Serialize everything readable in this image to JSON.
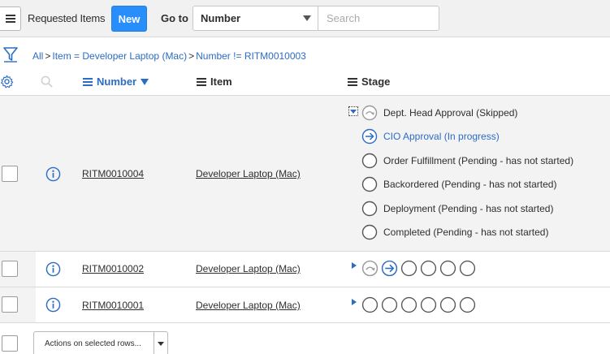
{
  "header": {
    "menu_icon": "hamburger-menu-icon",
    "title": "Requested Items",
    "new_label": "New",
    "goto_label": "Go to",
    "goto_field": "Number",
    "search_placeholder": "Search"
  },
  "breadcrumb": {
    "items": [
      "All",
      "Item = Developer Laptop (Mac)",
      "Number != RITM0010003"
    ],
    "separator": ">"
  },
  "columns": {
    "number": "Number",
    "item": "Item",
    "stage": "Stage"
  },
  "rows": [
    {
      "number": "RITM0010004",
      "item": "Developer Laptop (Mac)",
      "expanded": true,
      "stages": [
        {
          "label": "Dept. Head Approval (Skipped)",
          "state": "skipped"
        },
        {
          "label": "CIO Approval (In progress)",
          "state": "in-progress"
        },
        {
          "label": "Order Fulfillment (Pending - has not started)",
          "state": "pending"
        },
        {
          "label": "Backordered (Pending - has not started)",
          "state": "pending"
        },
        {
          "label": "Deployment (Pending - has not started)",
          "state": "pending"
        },
        {
          "label": "Completed (Pending - has not started)",
          "state": "pending"
        }
      ]
    },
    {
      "number": "RITM0010002",
      "item": "Developer Laptop (Mac)",
      "expanded": false,
      "stage_states": [
        "skipped",
        "in-progress",
        "pending",
        "pending",
        "pending",
        "pending"
      ]
    },
    {
      "number": "RITM0010001",
      "item": "Developer Laptop (Mac)",
      "expanded": false,
      "stage_states": [
        "pending",
        "pending",
        "pending",
        "pending",
        "pending",
        "pending"
      ]
    }
  ],
  "footer": {
    "actions_label": "Actions on selected rows..."
  },
  "colors": {
    "accent": "#278efc",
    "link": "#2b6cc4",
    "row_shade": "#f3f3f3"
  }
}
